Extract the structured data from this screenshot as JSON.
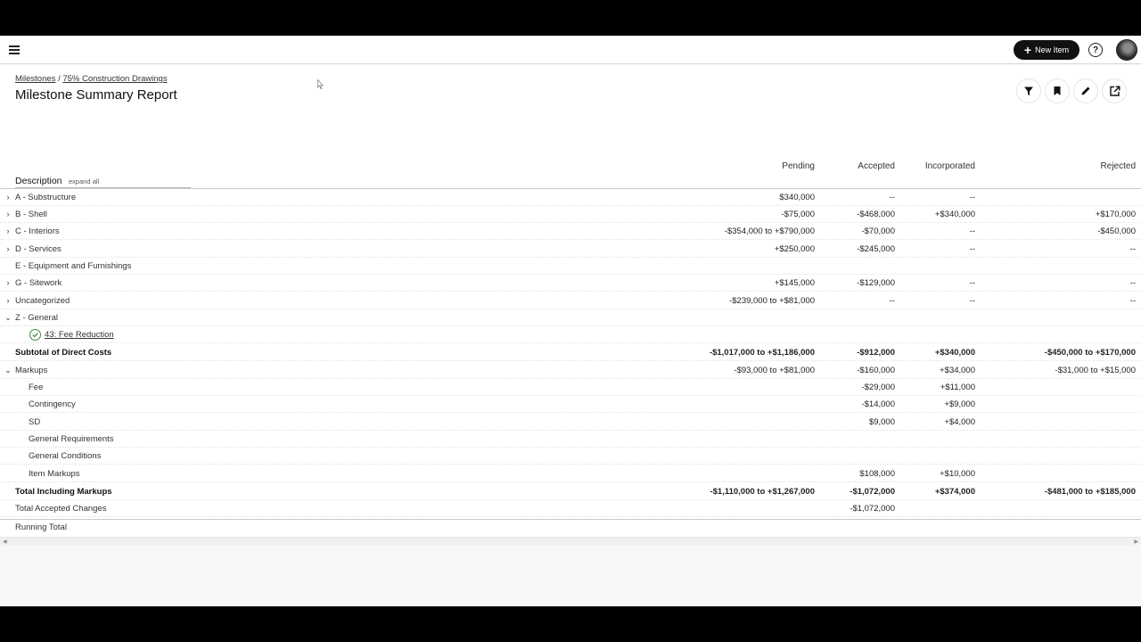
{
  "header": {
    "new_item_label": "New Item",
    "help_glyph": "?"
  },
  "breadcrumb": {
    "root": "Milestones",
    "separator": "/",
    "current": "75% Construction Drawings"
  },
  "page_title": "Milestone Summary Report",
  "table": {
    "description_header": "Description",
    "expand_all": "expand all",
    "columns": [
      "Pending",
      "Accepted",
      "Incorporated",
      "Rejected"
    ],
    "rows": [
      {
        "label": "A - Substructure",
        "pending": "$340,000",
        "accepted": "--",
        "incorporated": "--",
        "rejected": ""
      },
      {
        "label": "B - Shell",
        "pending": "-$75,000",
        "accepted": "-$468,000",
        "incorporated": "+$340,000",
        "rejected": "+$170,000"
      },
      {
        "label": "C - Interiors",
        "pending": "-$354,000 to +$790,000",
        "accepted": "-$70,000",
        "incorporated": "--",
        "rejected": "-$450,000"
      },
      {
        "label": "D - Services",
        "pending": "+$250,000",
        "accepted": "-$245,000",
        "incorporated": "--",
        "rejected": "--"
      },
      {
        "label": "E - Equipment and Furnishings",
        "pending": "",
        "accepted": "",
        "incorporated": "",
        "rejected": ""
      },
      {
        "label": "G - Sitework",
        "pending": "+$145,000",
        "accepted": "-$129,000",
        "incorporated": "--",
        "rejected": "--"
      },
      {
        "label": "Uncategorized",
        "pending": "-$239,000 to +$81,000",
        "accepted": "--",
        "incorporated": "--",
        "rejected": "--"
      },
      {
        "label": "Z - General",
        "pending": "",
        "accepted": "",
        "incorporated": "",
        "rejected": ""
      },
      {
        "label": "43: Fee Reduction",
        "pending": "",
        "accepted": "",
        "incorporated": "",
        "rejected": ""
      },
      {
        "label": "Subtotal of Direct Costs",
        "pending": "-$1,017,000 to +$1,186,000",
        "accepted": "-$912,000",
        "incorporated": "+$340,000",
        "rejected": "-$450,000 to +$170,000"
      },
      {
        "label": "Markups",
        "pending": "-$93,000 to +$81,000",
        "accepted": "-$160,000",
        "incorporated": "+$34,000",
        "rejected": "-$31,000 to +$15,000"
      },
      {
        "label": "Fee",
        "pending": "",
        "accepted": "-$29,000",
        "incorporated": "+$11,000",
        "rejected": ""
      },
      {
        "label": "Contingency",
        "pending": "",
        "accepted": "-$14,000",
        "incorporated": "+$9,000",
        "rejected": ""
      },
      {
        "label": "SD",
        "pending": "",
        "accepted": "$9,000",
        "incorporated": "+$4,000",
        "rejected": ""
      },
      {
        "label": "General Requirements",
        "pending": "",
        "accepted": "",
        "incorporated": "",
        "rejected": ""
      },
      {
        "label": "General Conditions",
        "pending": "",
        "accepted": "",
        "incorporated": "",
        "rejected": ""
      },
      {
        "label": "Item Markups",
        "pending": "",
        "accepted": "$108,000",
        "incorporated": "+$10,000",
        "rejected": ""
      },
      {
        "label": "Total Including Markups",
        "pending": "-$1,110,000 to +$1,267,000",
        "accepted": "-$1,072,000",
        "incorporated": "+$374,000",
        "rejected": "-$481,000 to +$185,000"
      },
      {
        "label": "Total Accepted Changes",
        "pending": "",
        "accepted": "-$1,072,000",
        "incorporated": "",
        "rejected": ""
      }
    ],
    "running_total": "Running Total"
  },
  "icons": {
    "menu": "hamburger-icon",
    "new_item": "plus-icon",
    "help": "help-icon",
    "filter": "filter-icon",
    "bookmark": "bookmark-icon",
    "edit": "pencil-icon",
    "share": "share-icon",
    "status": "check-circle-icon"
  },
  "colors": {
    "button_dark": "#111111",
    "status_green": "#3a8b3a"
  }
}
